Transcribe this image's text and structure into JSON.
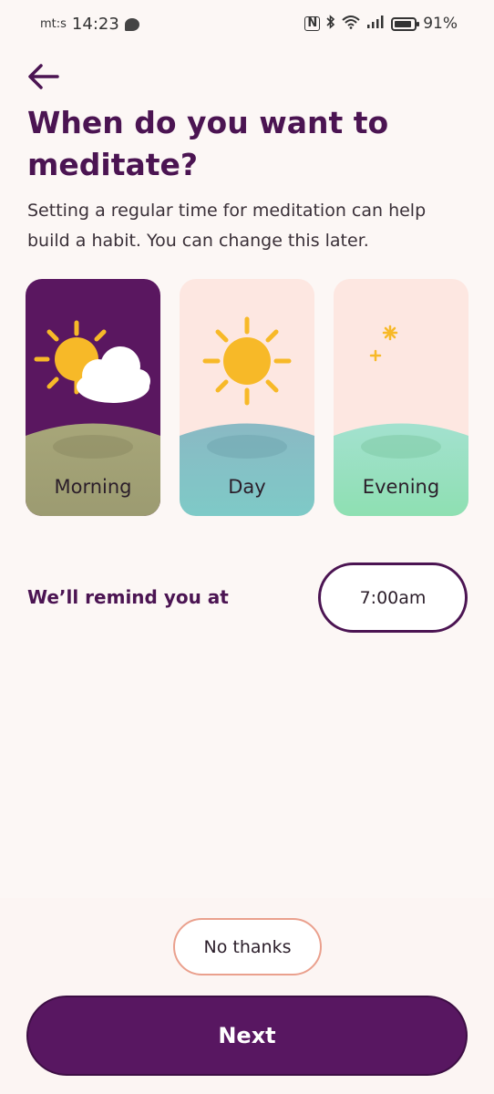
{
  "status_bar": {
    "carrier": "mt:s",
    "time": "14:23",
    "battery_percent": "91%",
    "battery_level": 0.91,
    "icons": [
      "message-icon",
      "nfc-icon",
      "bluetooth-icon",
      "wifi-icon",
      "signal-icon",
      "battery-icon"
    ]
  },
  "header": {
    "back_icon": "arrow-left-icon",
    "title": "When do you want to meditate?",
    "subtitle": "Setting a regular time for meditation can help build a habit. You can change this later."
  },
  "time_options": [
    {
      "label": "Morning",
      "selected": true,
      "icon": "sun-cloud-icon"
    },
    {
      "label": "Day",
      "selected": false,
      "icon": "sun-icon"
    },
    {
      "label": "Evening",
      "selected": false,
      "icon": "moon-icon"
    }
  ],
  "reminder": {
    "label": "We’ll remind you at",
    "time": "7:00am"
  },
  "actions": {
    "no_thanks": "No thanks",
    "next": "Next"
  },
  "colors": {
    "primary": "#581761",
    "title": "#4b1452",
    "background": "#fcf7f5",
    "card_bg": "#fde7e1",
    "no_thanks_border": "#eaa08d"
  }
}
